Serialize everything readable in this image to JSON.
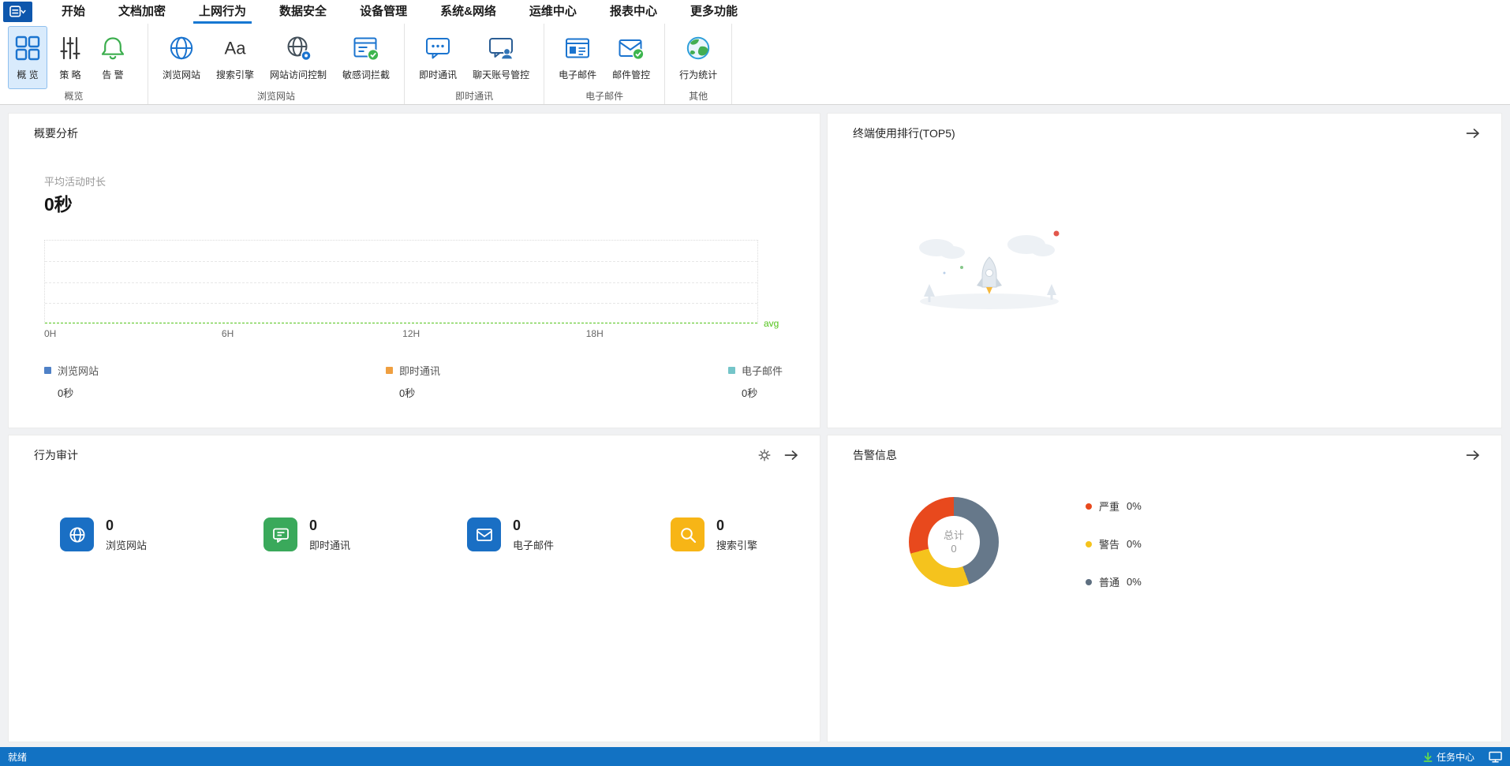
{
  "app": {
    "menu_items": [
      {
        "label": "开始"
      },
      {
        "label": "文档加密"
      },
      {
        "label": "上网行为",
        "active": true
      },
      {
        "label": "数据安全"
      },
      {
        "label": "设备管理"
      },
      {
        "label": "系统&网络"
      },
      {
        "label": "运维中心"
      },
      {
        "label": "报表中心"
      },
      {
        "label": "更多功能"
      }
    ]
  },
  "ribbon": {
    "groups": [
      {
        "label": "概览",
        "items": [
          {
            "label": "概 览",
            "icon": "overview-grid-icon",
            "active": true
          },
          {
            "label": "策 略",
            "icon": "policy-sliders-icon"
          },
          {
            "label": "告 警",
            "icon": "alarm-bell-icon"
          }
        ]
      },
      {
        "label": "浏览网站",
        "items": [
          {
            "label": "浏览网站",
            "icon": "browse-website-icon"
          },
          {
            "label": "搜索引擎",
            "icon": "search-engine-icon"
          },
          {
            "label": "网站访问控制",
            "icon": "website-access-control-icon"
          },
          {
            "label": "敏感词拦截",
            "icon": "sensitive-word-block-icon"
          }
        ]
      },
      {
        "label": "即时通讯",
        "items": [
          {
            "label": "即时通讯",
            "icon": "instant-message-icon"
          },
          {
            "label": "聊天账号管控",
            "icon": "chat-account-control-icon"
          }
        ]
      },
      {
        "label": "电子邮件",
        "items": [
          {
            "label": "电子邮件",
            "icon": "email-icon"
          },
          {
            "label": "邮件管控",
            "icon": "email-control-icon"
          }
        ]
      },
      {
        "label": "其他",
        "items": [
          {
            "label": "行为统计",
            "icon": "behavior-stats-icon"
          }
        ]
      }
    ]
  },
  "summary_card": {
    "title": "概要分析",
    "metric_label": "平均活动时长",
    "metric_value": "0秒"
  },
  "ranking_card": {
    "title": "终端使用排行(TOP5)"
  },
  "audit_card": {
    "title": "行为审计",
    "stats": [
      {
        "label": "浏览网站",
        "value": "0",
        "icon": "globe-stat-icon",
        "color": "#1a6fc4"
      },
      {
        "label": "即时通讯",
        "value": "0",
        "icon": "chat-stat-icon",
        "color": "#3aa95b"
      },
      {
        "label": "电子邮件",
        "value": "0",
        "icon": "mail-stat-icon",
        "color": "#1a6fc4"
      },
      {
        "label": "搜索引擎",
        "value": "0",
        "icon": "search-stat-icon",
        "color": "#f7b516"
      }
    ]
  },
  "alarm_card": {
    "title": "告警信息",
    "center_label": "总计",
    "center_value": "0"
  },
  "statusbar": {
    "ready": "就绪",
    "task_center": "任务中心"
  },
  "colors": {
    "accent_blue": "#1677d2",
    "statusbar_blue": "#1272c3",
    "avg_green": "#52c41a"
  },
  "chart_data": [
    {
      "type": "line",
      "title": "平均活动时长",
      "x_ticks": [
        "0H",
        "6H",
        "12H",
        "18H"
      ],
      "x_range_hours": [
        0,
        24
      ],
      "grid": true,
      "avg_line": {
        "label": "avg",
        "value": 0,
        "color": "#52c41a",
        "style": "dashed"
      },
      "series": [
        {
          "name": "浏览网站",
          "values": [
            0,
            0,
            0,
            0
          ],
          "total_display": "0秒",
          "color": "#4f81c7"
        },
        {
          "name": "即时通讯",
          "values": [
            0,
            0,
            0,
            0
          ],
          "total_display": "0秒",
          "color": "#ef9f40"
        },
        {
          "name": "电子邮件",
          "values": [
            0,
            0,
            0,
            0
          ],
          "total_display": "0秒",
          "color": "#74c5c9"
        }
      ]
    },
    {
      "type": "pie",
      "donut": true,
      "title": "告警信息",
      "center_label": "总计",
      "center_value": 0,
      "legend_position": "right",
      "slices": [
        {
          "label": "严重",
          "pct_label": "0%",
          "value": 0,
          "color": "#e8491d"
        },
        {
          "label": "警告",
          "pct_label": "0%",
          "value": 0,
          "color": "#f5c31d"
        },
        {
          "label": "普通",
          "pct_label": "0%",
          "value": 0,
          "color": "#5e6f80"
        }
      ],
      "display_segments": [
        {
          "color": "#66788a",
          "deg": 160
        },
        {
          "color": "#f5c31d",
          "deg": 95
        },
        {
          "color": "#e8491d",
          "deg": 105
        }
      ]
    }
  ]
}
